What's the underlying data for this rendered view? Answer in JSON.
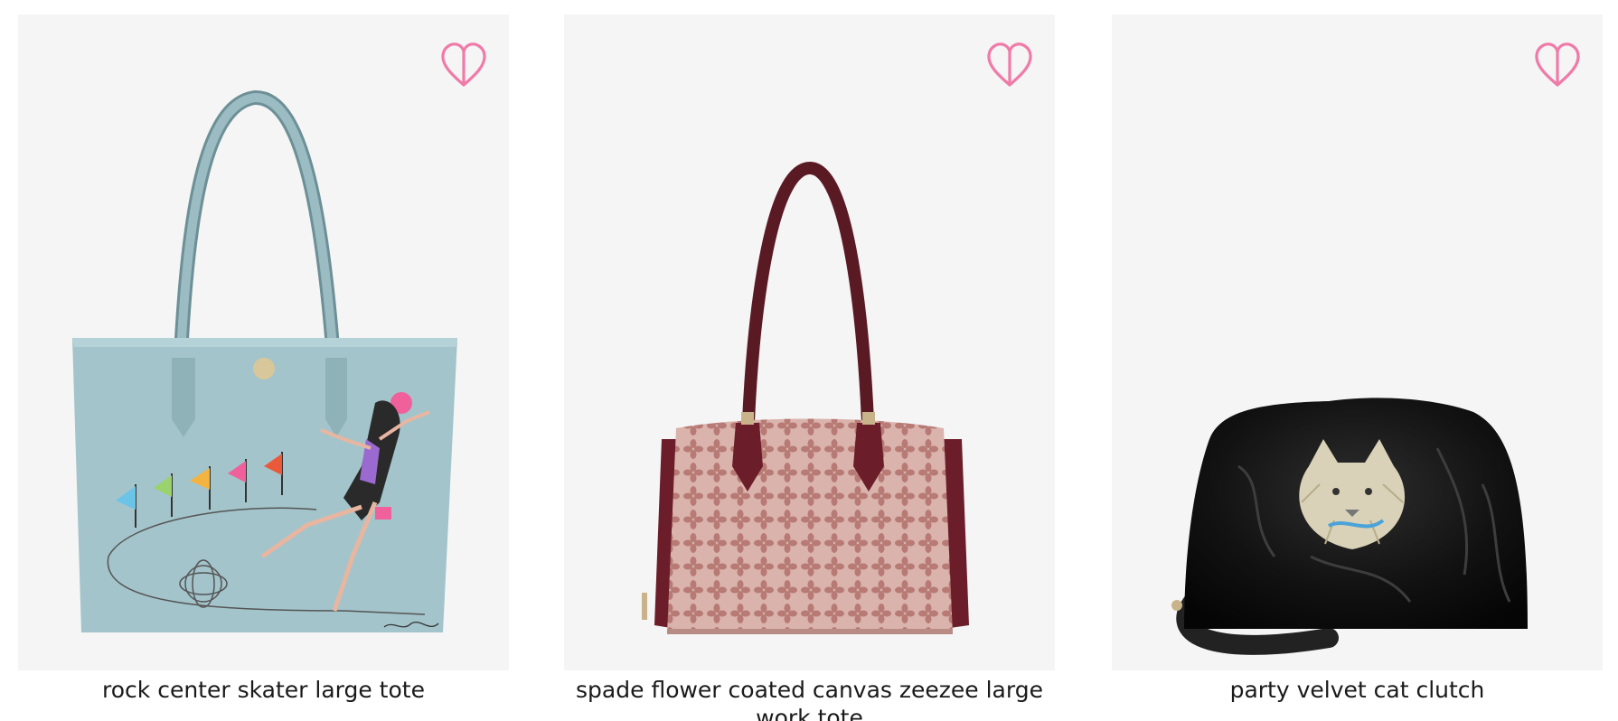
{
  "products": [
    {
      "name": "rock center skater large tote",
      "image_alt": "light blue tote bag with illustrated figure skater",
      "wishlist_icon": "heart-outline-icon"
    },
    {
      "name": "spade flower coated canvas zeezee large work tote",
      "image_alt": "pink spade flower pattern work tote with burgundy handles",
      "wishlist_icon": "heart-outline-icon"
    },
    {
      "name": "party velvet cat clutch",
      "image_alt": "black crushed velvet clutch with embellished cat",
      "wishlist_icon": "heart-outline-icon"
    }
  ],
  "colors": {
    "tile_background": "#f5f5f5",
    "wishlist_pink": "#f07aa8",
    "text": "#1a1a1a"
  }
}
